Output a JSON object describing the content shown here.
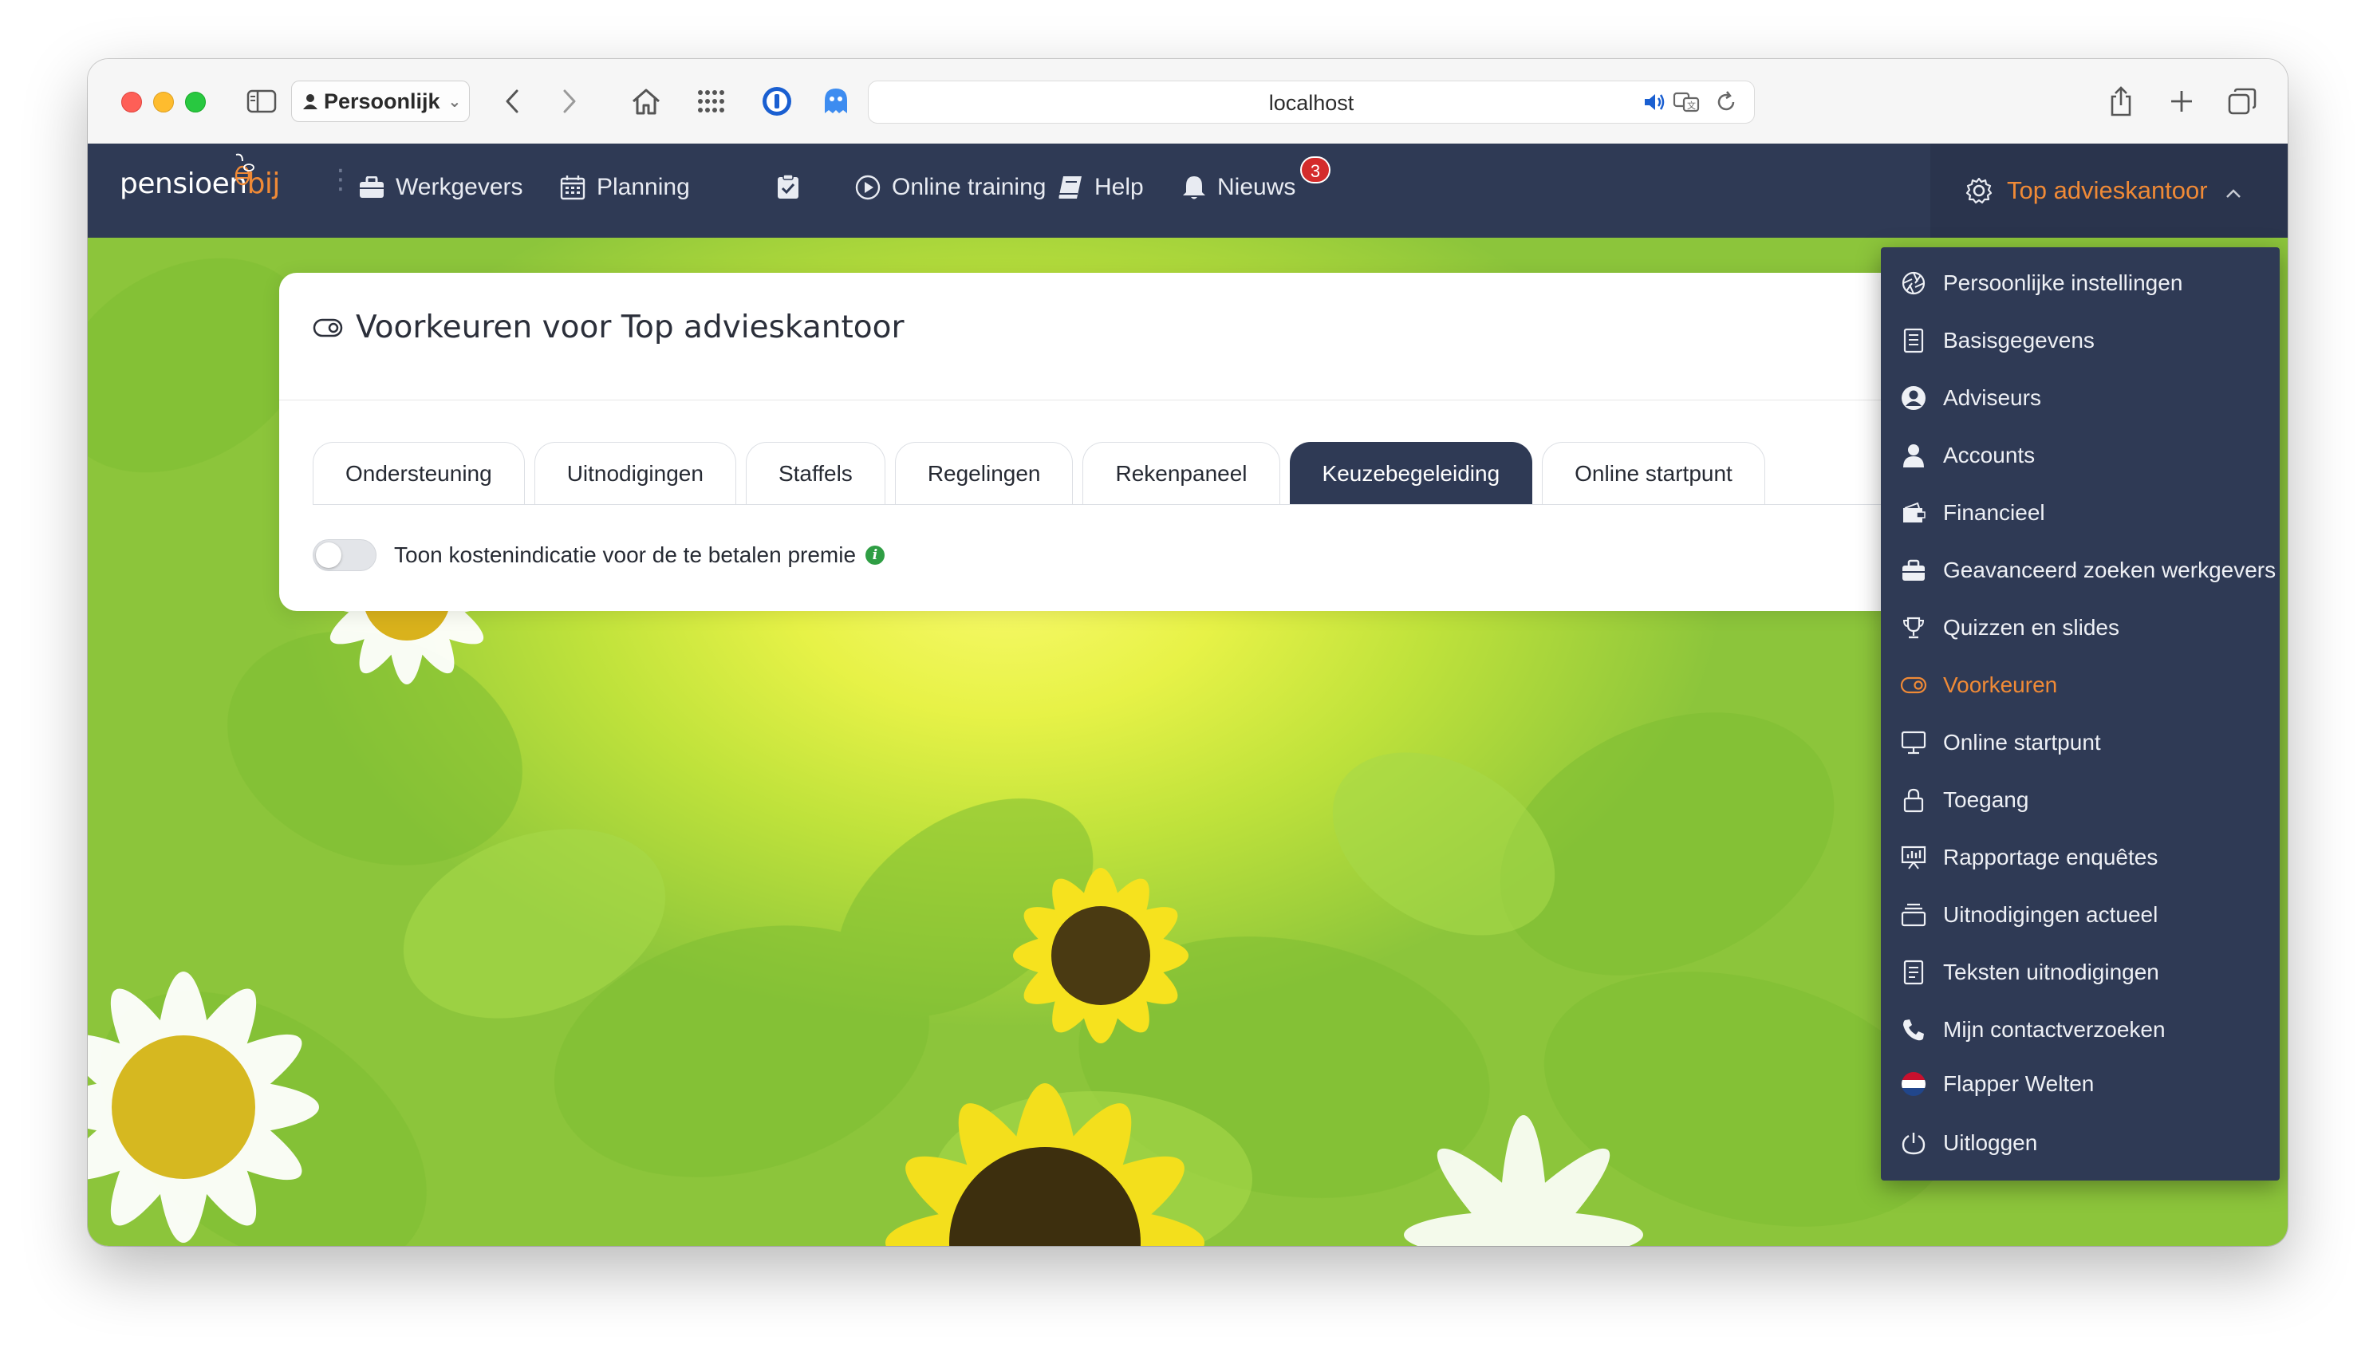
{
  "browser": {
    "profile_label": "Persoonlijk",
    "url": "localhost"
  },
  "nav": {
    "logo_text": "pensioen",
    "logo_accent": "bij",
    "items": [
      {
        "label": "Werkgevers",
        "icon": "briefcase-icon"
      },
      {
        "label": "Planning",
        "icon": "calendar-icon"
      },
      {
        "label": "",
        "icon": "clipboard-check-icon"
      },
      {
        "label": "Online training",
        "icon": "play-circle-icon"
      },
      {
        "label": "Help",
        "icon": "book-icon"
      },
      {
        "label": "Nieuws",
        "icon": "bell-icon"
      }
    ],
    "news_badge": "3",
    "org_label": "Top advieskantoor"
  },
  "card": {
    "title": "Voorkeuren voor Top advieskantoor",
    "tabs": [
      {
        "label": "Ondersteuning",
        "active": false
      },
      {
        "label": "Uitnodigingen",
        "active": false
      },
      {
        "label": "Staffels",
        "active": false
      },
      {
        "label": "Regelingen",
        "active": false
      },
      {
        "label": "Rekenpaneel",
        "active": false
      },
      {
        "label": "Keuzebegeleiding",
        "active": true
      },
      {
        "label": "Online startpunt",
        "active": false
      }
    ],
    "toggle_label": "Toon kostenindicatie voor de te betalen premie",
    "toggle_on": false
  },
  "menu": {
    "items": [
      {
        "label": "Persoonlijke instellingen",
        "icon": "aperture-icon"
      },
      {
        "label": "Basisgegevens",
        "icon": "document-list-icon"
      },
      {
        "label": "Adviseurs",
        "icon": "user-circle-icon"
      },
      {
        "label": "Accounts",
        "icon": "user-icon"
      },
      {
        "label": "Financieel",
        "icon": "wallet-icon"
      },
      {
        "label": "Geavanceerd zoeken werkgevers",
        "icon": "briefcase-icon"
      },
      {
        "label": "Quizzen en slides",
        "icon": "trophy-icon"
      },
      {
        "label": "Voorkeuren",
        "icon": "toggle-icon",
        "active": true
      },
      {
        "label": "Online startpunt",
        "icon": "monitor-icon"
      },
      {
        "label": "Toegang",
        "icon": "lock-icon"
      },
      {
        "label": "Rapportage enquêtes",
        "icon": "presentation-chart-icon"
      },
      {
        "label": "Uitnodigingen actueel",
        "icon": "inbox-stack-icon"
      },
      {
        "label": "Teksten uitnodigingen",
        "icon": "text-document-icon"
      },
      {
        "label": "Mijn contactverzoeken",
        "icon": "phone-icon"
      },
      {
        "label": "Flapper Welten",
        "icon": "dutch-flag-icon"
      },
      {
        "label": "Uitloggen",
        "icon": "power-icon"
      }
    ]
  },
  "colors": {
    "nav_bg": "#2f3a55",
    "accent": "#f08a36",
    "active_tab": "#2f3a55",
    "badge": "#d42b2b"
  }
}
